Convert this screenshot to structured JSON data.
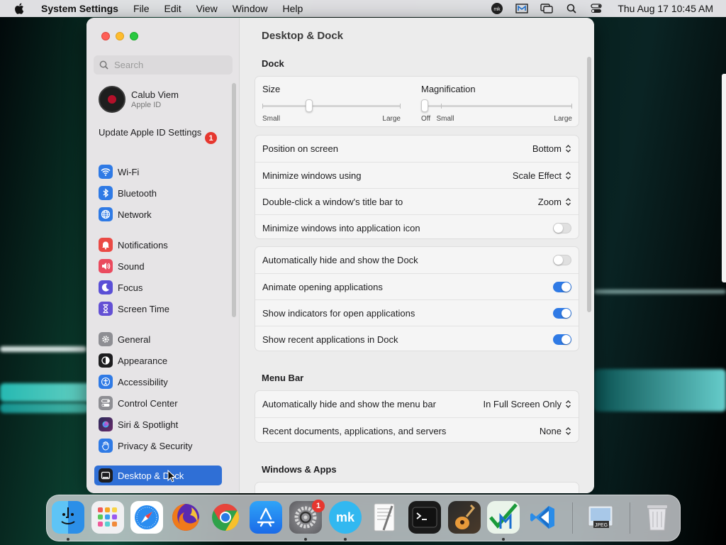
{
  "menubar": {
    "app_name": "System Settings",
    "items": [
      "File",
      "Edit",
      "View",
      "Window",
      "Help"
    ],
    "clock": "Thu Aug 17  10:45 AM",
    "icons": [
      "mk-icon",
      "m-app-icon",
      "screens-icon",
      "spotlight-icon",
      "control-center-icon"
    ]
  },
  "sidebar": {
    "search_placeholder": "Search",
    "account": {
      "name": "Calub Viem",
      "subtitle": "Apple ID"
    },
    "update": {
      "label": "Update Apple ID Settings",
      "badge": "1"
    },
    "items": [
      {
        "label": "Wi-Fi",
        "icon": "wifi-icon",
        "color": "#2f7ae5"
      },
      {
        "label": "Bluetooth",
        "icon": "bluetooth-icon",
        "color": "#2f7ae5"
      },
      {
        "label": "Network",
        "icon": "globe-icon",
        "color": "#2f7ae5"
      },
      {
        "label": "Notifications",
        "icon": "bell-icon",
        "color": "#ea4a45"
      },
      {
        "label": "Sound",
        "icon": "speaker-icon",
        "color": "#ea4a5e"
      },
      {
        "label": "Focus",
        "icon": "moon-icon",
        "color": "#5a4fd6"
      },
      {
        "label": "Screen Time",
        "icon": "hourglass-icon",
        "color": "#6350d4"
      },
      {
        "label": "General",
        "icon": "gear-icon",
        "color": "#8e8e93"
      },
      {
        "label": "Appearance",
        "icon": "appearance-icon",
        "color": "#1d1d1f"
      },
      {
        "label": "Accessibility",
        "icon": "accessibility-icon",
        "color": "#2f7ae5"
      },
      {
        "label": "Control Center",
        "icon": "switches-icon",
        "color": "#8e8e93"
      },
      {
        "label": "Siri & Spotlight",
        "icon": "siri-icon",
        "color": "#3a2a5a"
      },
      {
        "label": "Privacy & Security",
        "icon": "hand-icon",
        "color": "#2f7ae5"
      },
      {
        "label": "Desktop & Dock",
        "icon": "dock-icon",
        "color": "#1d1d1f"
      }
    ]
  },
  "content": {
    "title": "Desktop & Dock",
    "dock_section": "Dock",
    "size": {
      "label": "Size",
      "min_label": "Small",
      "max_label": "Large",
      "value": 0.33
    },
    "magnification": {
      "label": "Magnification",
      "off_label": "Off",
      "min_label": "Small",
      "max_label": "Large",
      "value": 0.0
    },
    "popups": [
      {
        "label": "Position on screen",
        "value": "Bottom"
      },
      {
        "label": "Minimize windows using",
        "value": "Scale Effect"
      },
      {
        "label": "Double-click a window's title bar to",
        "value": "Zoom"
      }
    ],
    "minimize_into_icon": {
      "label": "Minimize windows into application icon",
      "on": false
    },
    "toggles": [
      {
        "label": "Automatically hide and show the Dock",
        "on": false
      },
      {
        "label": "Animate opening applications",
        "on": true
      },
      {
        "label": "Show indicators for open applications",
        "on": true
      },
      {
        "label": "Show recent applications in Dock",
        "on": true
      }
    ],
    "menubar_section": "Menu Bar",
    "menubar_rows": [
      {
        "label": "Automatically hide and show the menu bar",
        "value": "In Full Screen Only"
      },
      {
        "label": "Recent documents, applications, and servers",
        "value": "None"
      }
    ],
    "windows_section": "Windows & Apps"
  },
  "dock": {
    "apps": [
      {
        "name": "finder-icon",
        "running": true
      },
      {
        "name": "launchpad-icon",
        "running": false
      },
      {
        "name": "safari-icon",
        "running": false
      },
      {
        "name": "firefox-icon",
        "running": false
      },
      {
        "name": "chrome-icon",
        "running": false
      },
      {
        "name": "app-store-icon",
        "running": false
      },
      {
        "name": "system-settings-icon",
        "running": true,
        "badge": "1"
      },
      {
        "name": "mk-app-icon",
        "running": true
      },
      {
        "name": "textedit-icon",
        "running": false
      },
      {
        "name": "terminal-icon",
        "running": false
      },
      {
        "name": "garageband-icon",
        "running": false
      },
      {
        "name": "m-checkmark-icon",
        "running": true
      },
      {
        "name": "vscode-icon",
        "running": false
      },
      {
        "name": "preview-icon",
        "running": false
      },
      {
        "name": "trash-icon",
        "running": false
      }
    ]
  }
}
